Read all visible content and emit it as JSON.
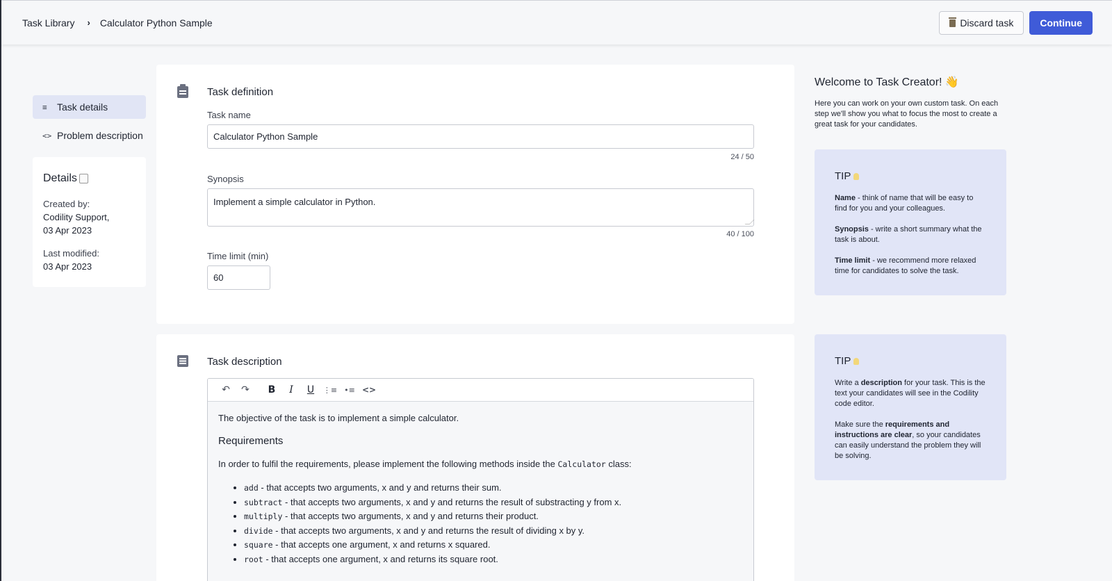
{
  "header": {
    "breadcrumb": [
      "Task Library",
      "Calculator Python Sample"
    ],
    "separator": "›",
    "discard_label": "Discard task",
    "continue_label": "Continue"
  },
  "nav": {
    "items": [
      {
        "label": "Task details",
        "icon": "list-icon",
        "glyph": "≡",
        "active": true
      },
      {
        "label": "Problem description",
        "icon": "code-icon",
        "glyph": "<>",
        "active": false
      }
    ]
  },
  "details": {
    "title": "Details",
    "created_label": "Created by:",
    "created_by": "Codility Support,",
    "created_date": "03 Apr 2023",
    "modified_label": "Last modified:",
    "modified_date": "03 Apr 2023"
  },
  "task_definition": {
    "title": "Task definition",
    "task_name_label": "Task name",
    "task_name": "Calculator Python Sample",
    "task_name_counter": "24 / 50",
    "synopsis_label": "Synopsis",
    "synopsis": "Implement a simple calculator in Python.",
    "synopsis_counter": "40 / 100",
    "time_limit_label": "Time limit (min)",
    "time_limit": "60"
  },
  "task_description": {
    "title": "Task description",
    "toolbar": [
      "↶",
      "↷",
      "B",
      "I",
      "U",
      "⋮≡",
      "•≡",
      "<>"
    ],
    "intro": "The objective of the task is to implement a simple calculator.",
    "heading": "Requirements",
    "req_text_before": "In order to fulfil the requirements, please implement the following methods inside the",
    "req_class": "Calculator",
    "req_text_after": "class:",
    "methods": [
      {
        "code": "add",
        "text": "- that accepts two arguments, x and y and returns their sum."
      },
      {
        "code": "subtract",
        "text": "- that accepts two arguments, x and y and returns the result of substracting y from x."
      },
      {
        "code": "multiply",
        "text": "- that accepts two arguments, x and y and returns their product."
      },
      {
        "code": "divide",
        "text": "- that accepts two arguments, x and y and returns the result of dividing x by y."
      },
      {
        "code": "square",
        "text": "- that accepts one argument, x and returns x squared."
      },
      {
        "code": "root",
        "text": "- that accepts one argument, x and returns its square root."
      }
    ]
  },
  "welcome": {
    "title": "Welcome to Task Creator! 👋",
    "text": "Here you can work on your own custom task. On each step we'll show you what to focus the most to create a great task for your candidates."
  },
  "tip1": {
    "title": "TIP",
    "items": [
      {
        "bold": "Name",
        "text": " - think of name that will be easy to find for you and your colleagues."
      },
      {
        "bold": "Synopsis",
        "text": " - write a short summary what the task is about."
      },
      {
        "bold": "Time limit",
        "text": " - we recommend more relaxed time for candidates to solve the task."
      }
    ]
  },
  "tip2": {
    "title": "TIP",
    "p1_before": "Write a ",
    "p1_bold": "description",
    "p1_after": " for your task. This is the text your candidates will see in the Codility code editor.",
    "p2_before": "Make sure the ",
    "p2_bold": "requirements and instructions are clear",
    "p2_after": ", so your candidates can easily understand the problem they will be solving."
  }
}
